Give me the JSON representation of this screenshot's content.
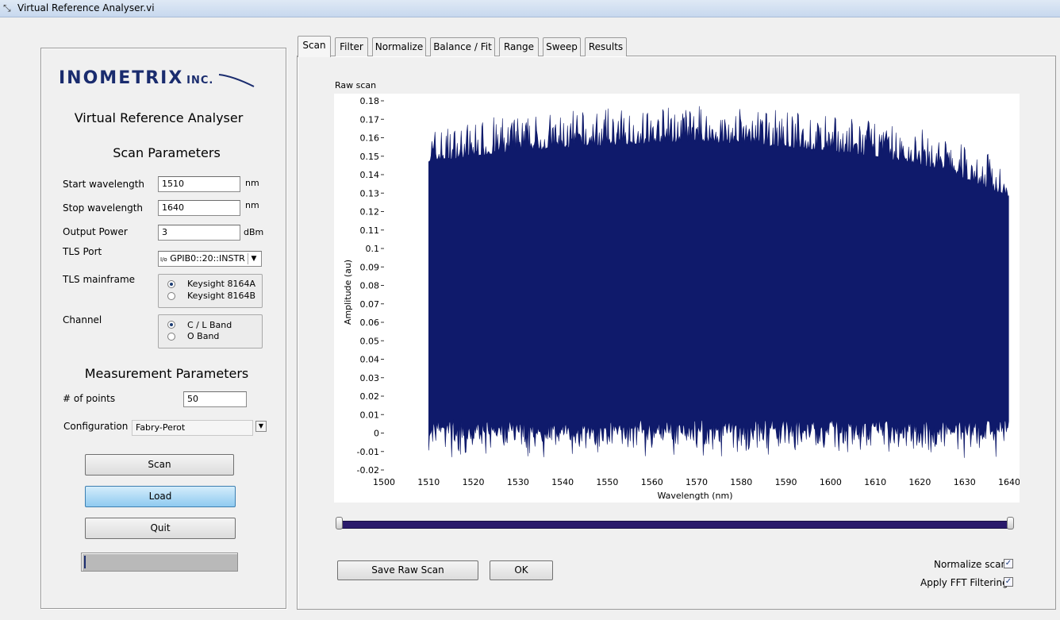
{
  "window": {
    "title": "Virtual Reference Analyser.vi"
  },
  "left_panel": {
    "logo_text": "INOMETRIX",
    "logo_suffix": "INC.",
    "app_title": "Virtual Reference Analyser",
    "scan_parameters": {
      "heading": "Scan Parameters",
      "start_wavelength": {
        "label": "Start wavelength",
        "value": "1510",
        "unit": "nm"
      },
      "stop_wavelength": {
        "label": "Stop wavelength",
        "value": "1640",
        "unit": "nm"
      },
      "output_power": {
        "label": "Output Power",
        "value": "3",
        "unit": "dBm"
      },
      "tls_port": {
        "label": "TLS Port",
        "prefix": "I/o",
        "value": "GPIB0::20::INSTR"
      },
      "tls_mainframe": {
        "label": "TLS mainframe",
        "options": [
          "Keysight 8164A",
          "Keysight 8164B"
        ],
        "selected": 0
      },
      "channel": {
        "label": "Channel",
        "options": [
          "C / L Band",
          "O Band"
        ],
        "selected": 0
      }
    },
    "measurement_parameters": {
      "heading": "Measurement Parameters",
      "num_points": {
        "label": "# of points",
        "value": "50"
      },
      "configuration": {
        "label": "Configuration",
        "value": "Fabry-Perot"
      }
    },
    "buttons": {
      "scan": "Scan",
      "load": "Load",
      "quit": "Quit"
    },
    "progress": 0.01
  },
  "tabs": [
    "Scan",
    "Filter",
    "Normalize",
    "Balance / Fit",
    "Range",
    "Sweep",
    "Results"
  ],
  "selected_tab": "Scan",
  "graph": {
    "label": "Raw scan"
  },
  "chart_data": {
    "type": "area",
    "title": "Raw scan",
    "xlabel": "Wavelength (nm)",
    "ylabel": "Amplitude (au)",
    "xlim": [
      1500,
      1640
    ],
    "ylim": [
      -0.02,
      0.18
    ],
    "x_ticks": [
      1500,
      1510,
      1520,
      1530,
      1540,
      1550,
      1560,
      1570,
      1580,
      1590,
      1600,
      1610,
      1620,
      1630,
      1640
    ],
    "y_ticks": [
      "0.18",
      "0.17",
      "0.16",
      "0.15",
      "0.14",
      "0.13",
      "0.12",
      "0.11",
      "0.1",
      "0.09",
      "0.08",
      "0.07",
      "0.06",
      "0.05",
      "0.04",
      "0.03",
      "0.02",
      "0.01",
      "0",
      "-0.01",
      "-0.02"
    ],
    "data_x_range": [
      1510,
      1640
    ],
    "upper_envelope": {
      "x": [
        1510,
        1530,
        1550,
        1570,
        1590,
        1610,
        1625,
        1640
      ],
      "y": [
        0.147,
        0.153,
        0.156,
        0.158,
        0.155,
        0.15,
        0.143,
        0.128
      ]
    },
    "lower_envelope": {
      "x": [
        1510,
        1640
      ],
      "y": [
        0.0,
        0.0
      ]
    },
    "series_color": "#0f1a6b",
    "grid": false
  },
  "range_slider": {
    "min": 1510,
    "max": 1640,
    "low": 1510,
    "high": 1640
  },
  "bottom": {
    "save_raw_scan": "Save Raw Scan",
    "ok": "OK",
    "normalize_scan": {
      "label": "Normalize scan",
      "checked": true
    },
    "apply_fft": {
      "label": "Apply FFT Filtering",
      "checked": true
    }
  }
}
